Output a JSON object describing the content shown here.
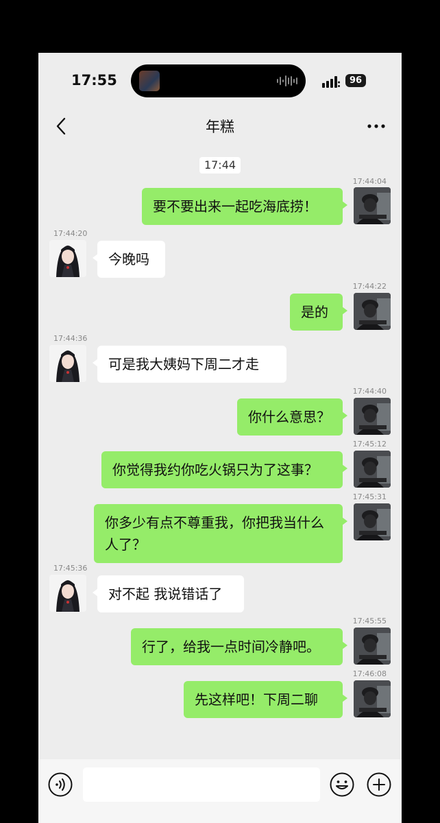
{
  "status": {
    "time": "17:55",
    "battery": "96"
  },
  "nav": {
    "title": "年糕"
  },
  "chat": {
    "time_chip": "17:44",
    "messages": [
      {
        "sender": "me",
        "ts": "17:44:04",
        "text": "要不要出来一起吃海底捞！"
      },
      {
        "sender": "her",
        "ts": "17:44:20",
        "text": "今晚吗"
      },
      {
        "sender": "me",
        "ts": "17:44:22",
        "text": "是的"
      },
      {
        "sender": "her",
        "ts": "17:44:36",
        "text": "可是我大姨妈下周二才走"
      },
      {
        "sender": "me",
        "ts": "17:44:40",
        "text": "你什么意思？"
      },
      {
        "sender": "me",
        "ts": "17:45:12",
        "text": "你觉得我约你吃火锅只为了这事？"
      },
      {
        "sender": "me",
        "ts": "17:45:31",
        "text": "你多少有点不尊重我，你把我当什么人了？"
      },
      {
        "sender": "her",
        "ts": "17:45:36",
        "text": "对不起 我说错话了"
      },
      {
        "sender": "me",
        "ts": "17:45:55",
        "text": "行了，给我一点时间冷静吧。"
      },
      {
        "sender": "me",
        "ts": "17:46:08",
        "text": "先这样吧！下周二聊"
      }
    ]
  },
  "input": {
    "voice_icon": "voice-icon",
    "emoji_icon": "emoji-icon",
    "plus_icon": "plus-icon"
  },
  "colors": {
    "my_bubble": "#95ec69",
    "her_bubble": "#ffffff",
    "background": "#ededed"
  }
}
